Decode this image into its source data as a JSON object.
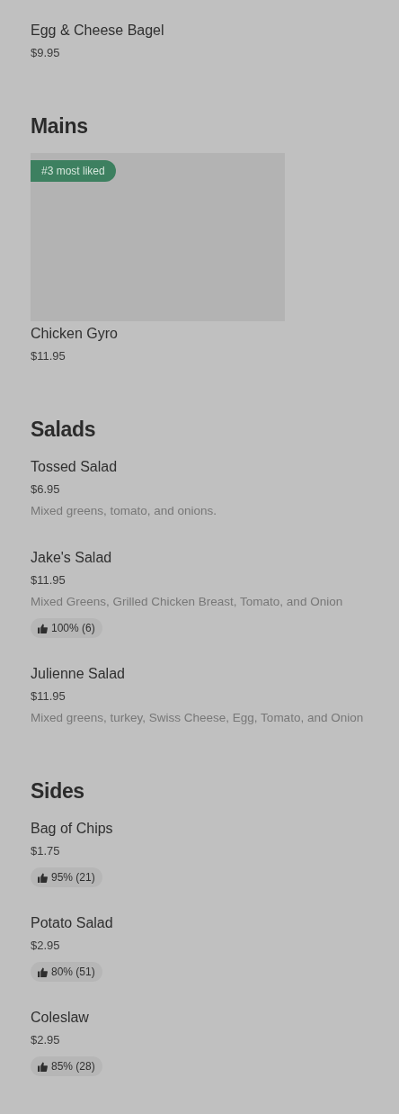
{
  "sections": [
    {
      "items": [
        {
          "name": "Egg & Cheese Bagel",
          "price": "$9.95"
        }
      ]
    },
    {
      "title": "Mains",
      "items": [
        {
          "name": "Chicken Gyro",
          "price": "$11.95",
          "image": {
            "kind": "placeholder",
            "badge": "#3 most liked"
          }
        }
      ]
    },
    {
      "title": "Salads",
      "items": [
        {
          "name": "Tossed Salad",
          "price": "$6.95",
          "description": "Mixed greens, tomato, and onions."
        },
        {
          "name": "Jake's Salad",
          "price": "$11.95",
          "description": "Mixed Greens, Grilled Chicken Breast, Tomato, and Onion",
          "rating": "100% (6)"
        },
        {
          "name": "Julienne Salad",
          "price": "$11.95",
          "description": "Mixed greens, turkey, Swiss Cheese, Egg, Tomato, and Onion"
        }
      ]
    },
    {
      "title": "Sides",
      "items": [
        {
          "name": "Bag of Chips",
          "price": "$1.75",
          "rating": "95% (21)"
        },
        {
          "name": "Potato Salad",
          "price": "$2.95",
          "rating": "80% (51)"
        },
        {
          "name": "Coleslaw",
          "price": "$2.95",
          "rating": "85% (28)"
        }
      ]
    }
  ]
}
